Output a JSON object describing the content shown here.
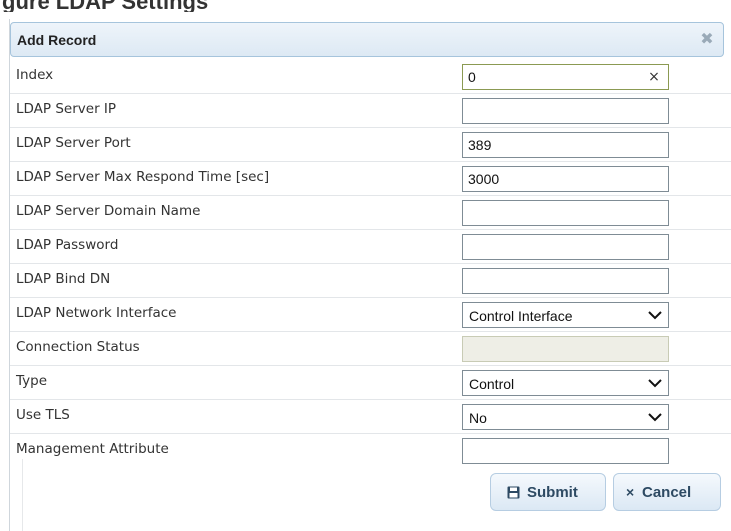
{
  "background_heading": "gure LDAP Settings",
  "dialog": {
    "title": "Add Record"
  },
  "fields": {
    "index": {
      "label": "Index",
      "value": "0"
    },
    "server_ip": {
      "label": "LDAP Server IP",
      "value": ""
    },
    "server_port": {
      "label": "LDAP Server Port",
      "value": "389"
    },
    "max_respond_time": {
      "label": "LDAP Server Max Respond Time [sec]",
      "value": "3000"
    },
    "domain_name": {
      "label": "LDAP Server Domain Name",
      "value": ""
    },
    "password": {
      "label": "LDAP Password",
      "value": ""
    },
    "bind_dn": {
      "label": "LDAP Bind DN",
      "value": ""
    },
    "network_interface": {
      "label": "LDAP Network Interface",
      "selected": "Control Interface"
    },
    "connection_status": {
      "label": "Connection Status",
      "value": ""
    },
    "type": {
      "label": "Type",
      "selected": "Control"
    },
    "use_tls": {
      "label": "Use TLS",
      "selected": "No"
    },
    "management_attribute": {
      "label": "Management Attribute",
      "value": ""
    }
  },
  "buttons": {
    "submit": "Submit",
    "cancel": "Cancel"
  },
  "colors": {
    "header_bg": "#dde9f4",
    "header_border": "#a6c4dc",
    "button_text": "#2d4a63",
    "disabled_field": "#eeeee6"
  }
}
